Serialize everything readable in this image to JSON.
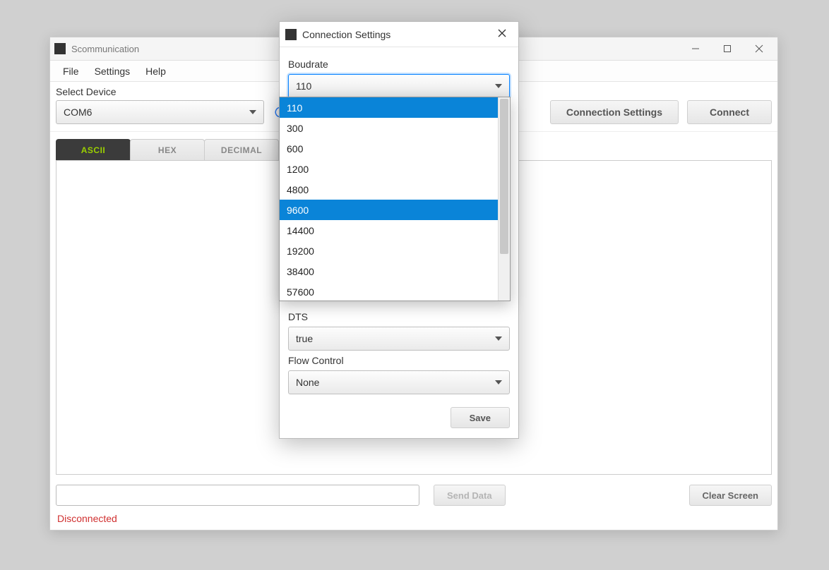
{
  "app": {
    "title": "Scommunication"
  },
  "menu": {
    "file": "File",
    "settings": "Settings",
    "help": "Help"
  },
  "toolbar": {
    "select_device_label": "Select Device",
    "device_value": "COM6",
    "conn_settings": "Connection Settings",
    "connect": "Connect"
  },
  "tabs": {
    "ascii": "ASCII",
    "hex": "HEX",
    "decimal": "DECIMAL"
  },
  "bottom": {
    "send": "Send Data",
    "clear": "Clear Screen"
  },
  "status": {
    "text": "Disconnected"
  },
  "dialog": {
    "title": "Connection Settings",
    "baud_label": "Boudrate",
    "baud_value": "110",
    "baud_options": [
      "110",
      "300",
      "600",
      "1200",
      "4800",
      "9600",
      "14400",
      "19200",
      "38400",
      "57600"
    ],
    "baud_selected": "110",
    "baud_hover": "9600",
    "dts_label": "DTS",
    "dts_value": "true",
    "flow_label": "Flow Control",
    "flow_value": "None",
    "save": "Save"
  }
}
